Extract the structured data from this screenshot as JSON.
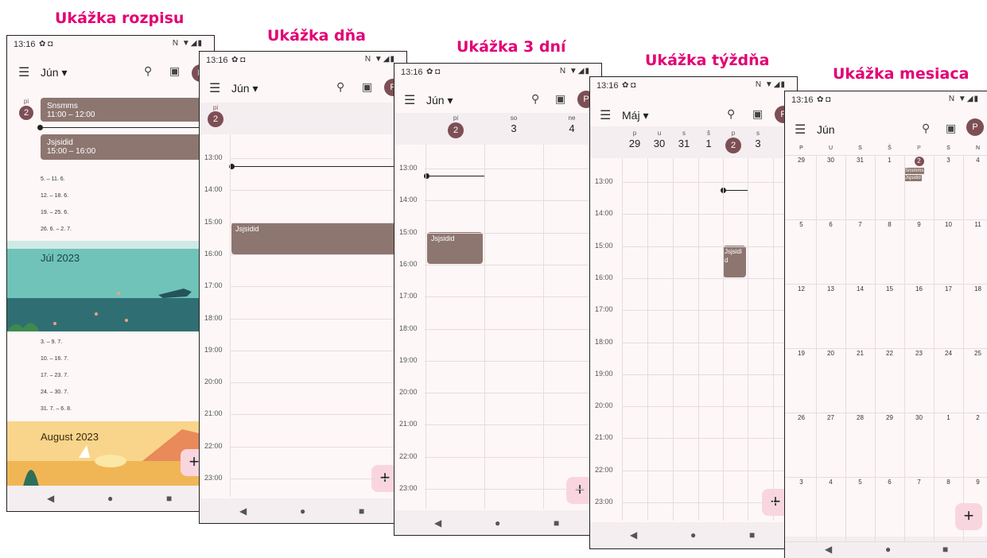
{
  "titles": {
    "schedule": "Ukážka rozpisu",
    "day": "Ukážka dňa",
    "three_day": "Ukážka 3 dní",
    "week": "Ukážka týždňa",
    "month": "Ukážka mesiaca"
  },
  "status": {
    "time": "13:16",
    "left_icons": "✿ ◘",
    "right_icons": "N ▼◢▮"
  },
  "avatar": "P",
  "fab": "+",
  "nav": {
    "back": "◀",
    "home": "●",
    "recents": "■"
  },
  "schedule": {
    "month": "Jún ▾",
    "day_name": "pi",
    "day_num": "2",
    "events": [
      {
        "title": "Snsmms",
        "time": "11:00 – 12:00"
      },
      {
        "title": "Jsjsidid",
        "time": "15:00 – 16:00"
      }
    ],
    "june_weeks": [
      "5. – 11. 6.",
      "12. – 18. 6.",
      "19. – 25. 6.",
      "26. 6. – 2. 7."
    ],
    "july_header": "Júl 2023",
    "july_weeks": [
      "3. – 9. 7.",
      "10. – 16. 7.",
      "17. – 23. 7.",
      "24. – 30. 7.",
      "31. 7. – 6. 8."
    ],
    "august_header": "August 2023"
  },
  "day": {
    "month": "Jún ▾",
    "day_name": "pi",
    "day_num": "2",
    "hours": [
      "13:00",
      "14:00",
      "15:00",
      "16:00",
      "17:00",
      "18:00",
      "19:00",
      "20:00",
      "21:00",
      "22:00",
      "23:00"
    ],
    "event": "Jsjsidid"
  },
  "three_day": {
    "month": "Jún ▾",
    "days": [
      {
        "n": "pi",
        "d": "2"
      },
      {
        "n": "so",
        "d": "3"
      },
      {
        "n": "ne",
        "d": "4"
      }
    ],
    "hours": [
      "13:00",
      "14:00",
      "15:00",
      "16:00",
      "17:00",
      "18:00",
      "19:00",
      "20:00",
      "21:00",
      "22:00",
      "23:00"
    ],
    "event": "Jsjsidid"
  },
  "week": {
    "month": "Máj ▾",
    "days": [
      {
        "n": "p",
        "d": "29"
      },
      {
        "n": "u",
        "d": "30"
      },
      {
        "n": "s",
        "d": "31"
      },
      {
        "n": "š",
        "d": "1"
      },
      {
        "n": "p",
        "d": "2"
      },
      {
        "n": "s",
        "d": "3"
      }
    ],
    "hours": [
      "13:00",
      "14:00",
      "15:00",
      "16:00",
      "17:00",
      "18:00",
      "19:00",
      "20:00",
      "21:00",
      "22:00",
      "23:00"
    ],
    "event": "Jsjsidi d"
  },
  "month": {
    "month": "Jún",
    "weekdays": [
      "P",
      "U",
      "S",
      "Š",
      "P",
      "S",
      "N"
    ],
    "rows": [
      [
        "29",
        "30",
        "31",
        "1",
        "2",
        "3",
        "4"
      ],
      [
        "5",
        "6",
        "7",
        "8",
        "9",
        "10",
        "11"
      ],
      [
        "12",
        "13",
        "14",
        "15",
        "16",
        "17",
        "18"
      ],
      [
        "19",
        "20",
        "21",
        "22",
        "23",
        "24",
        "25"
      ],
      [
        "26",
        "27",
        "28",
        "29",
        "30",
        "1",
        "2"
      ],
      [
        "3",
        "4",
        "5",
        "6",
        "7",
        "8",
        "9"
      ]
    ],
    "events": [
      "Snsmms",
      "Jsjsidid"
    ]
  }
}
